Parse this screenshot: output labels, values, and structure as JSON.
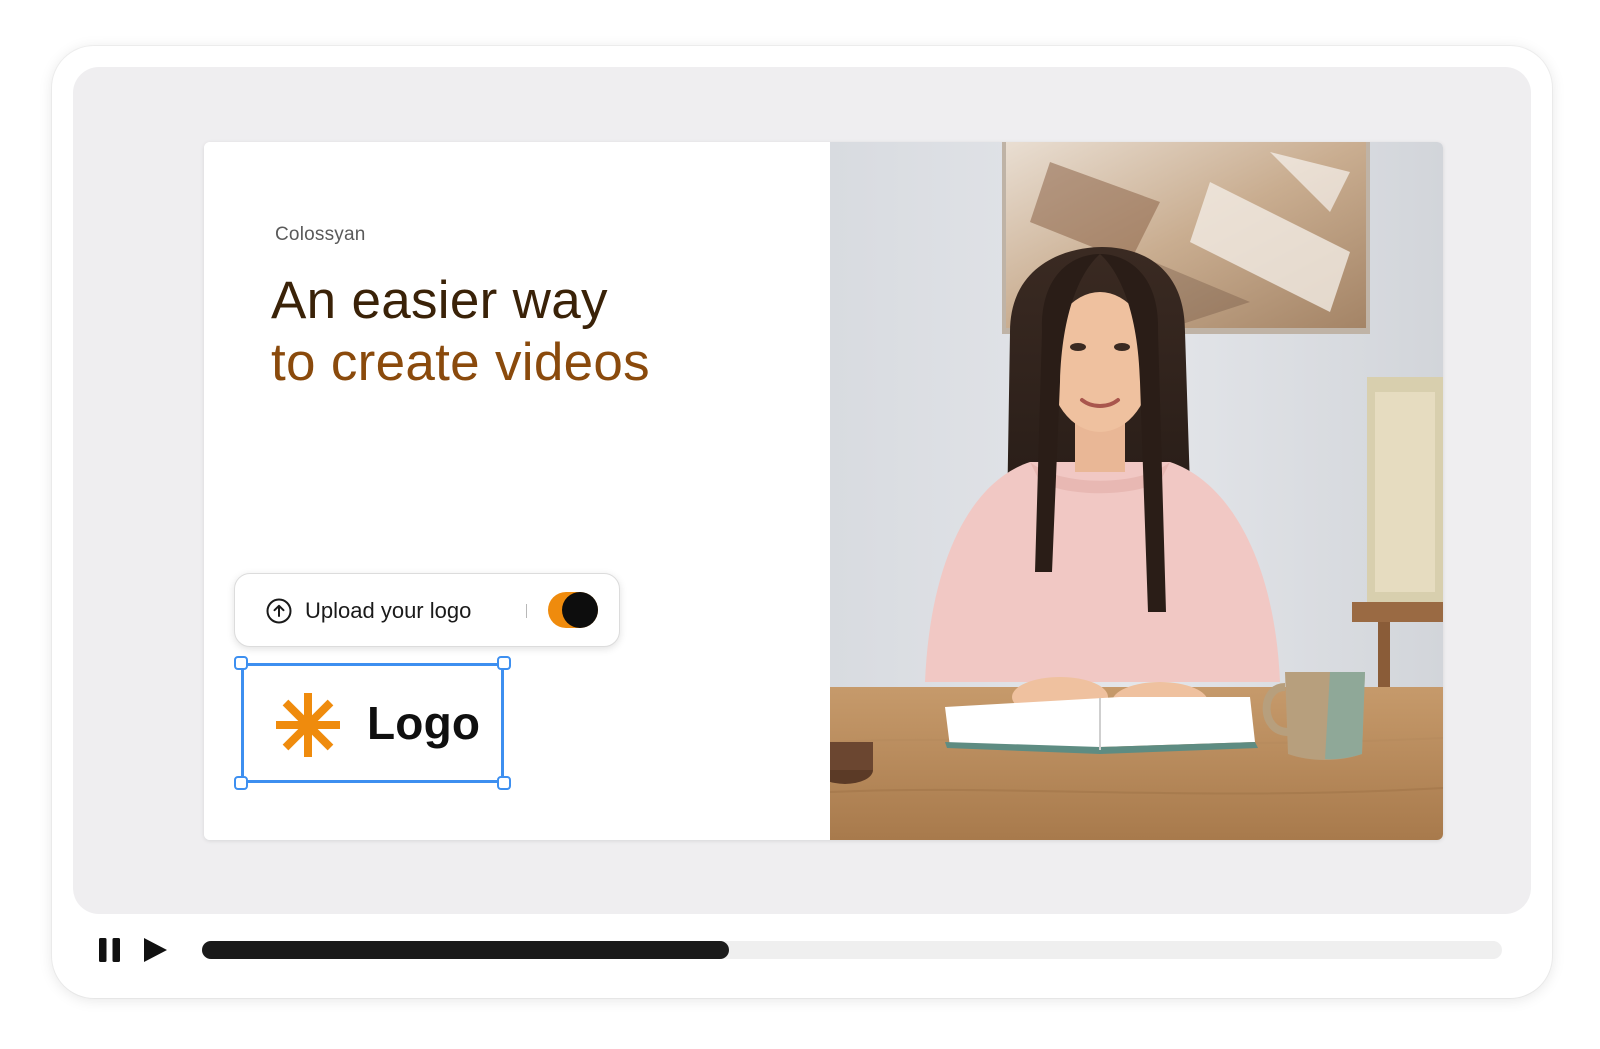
{
  "slide": {
    "brand": "Colossyan",
    "headline_line1": "An easier way",
    "headline_line2": "to create videos",
    "upload_label": "Upload your logo",
    "upload_divider": "|",
    "toggle_on": true,
    "logo_text": "Logo"
  },
  "player": {
    "progress": 0.405
  },
  "colors": {
    "accent_orange": "#ef8b0d",
    "selection_blue": "#3d8ff0",
    "headline_dark": "#3a2208",
    "headline_brown": "#8a4a0c",
    "progress_fill": "#1a1a1a"
  },
  "icons": {
    "upload": "upload-arrow-circle-icon",
    "logo": "asterisk-icon",
    "pause": "pause-icon",
    "play": "play-icon"
  }
}
